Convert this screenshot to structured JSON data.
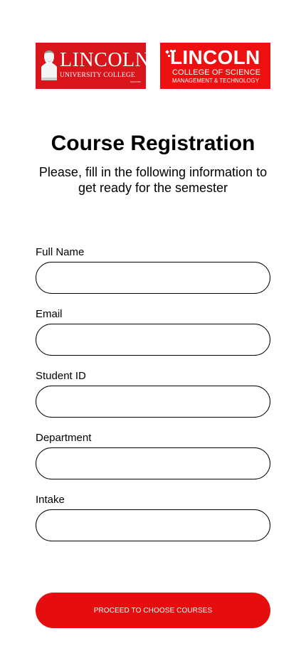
{
  "logos": {
    "university": {
      "word": "LINCOLN",
      "sub": "UNIVERSITY COLLEGE",
      "tiny": "MALAYSIA"
    },
    "college": {
      "word": "LINCOLN",
      "line1": "COLLEGE OF SCIENCE",
      "line2": "MANAGEMENT & TECHNOLOGY"
    }
  },
  "page": {
    "title": "Course Registration",
    "subtitle": "Please, fill in the following information to get ready for the semester"
  },
  "form": {
    "fields": [
      {
        "label": "Full Name",
        "value": "",
        "placeholder": ""
      },
      {
        "label": "Email",
        "value": "",
        "placeholder": ""
      },
      {
        "label": "Student ID",
        "value": "",
        "placeholder": ""
      },
      {
        "label": "Department",
        "value": "",
        "placeholder": ""
      },
      {
        "label": "Intake",
        "value": "",
        "placeholder": ""
      }
    ],
    "submit_label": "PROCEED TO CHOOSE COURSES"
  },
  "colors": {
    "brand_red": "#e50d0d",
    "logo_red_a": "#d9151c",
    "logo_red_b": "#ee1010",
    "input_border": "#000000"
  },
  "icons": {
    "university_logo": "lincoln-bust-icon",
    "college_logo": "graduation-cap-icon"
  }
}
